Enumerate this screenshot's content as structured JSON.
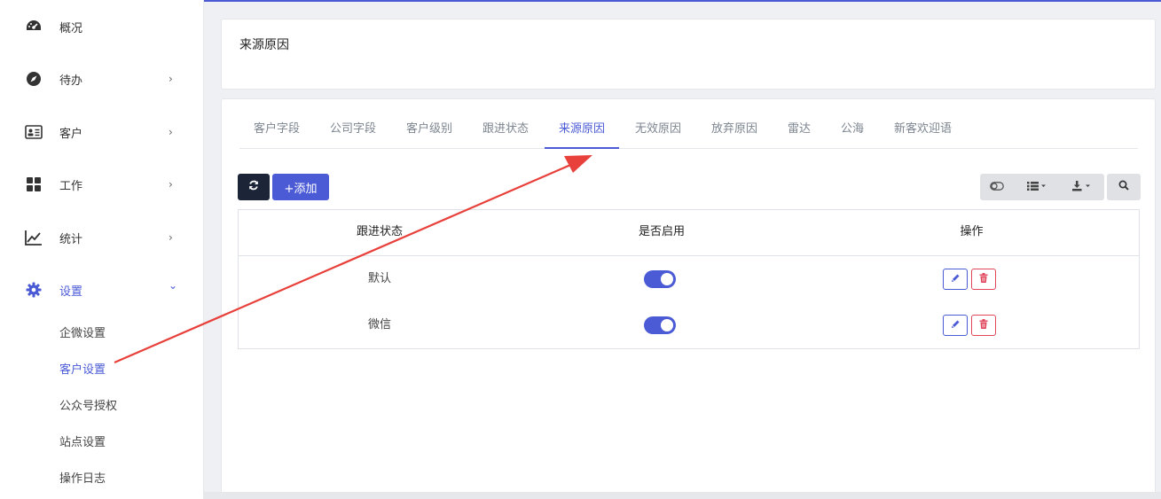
{
  "sidebar": {
    "items": [
      {
        "label": "概况",
        "icon": "dashboard-icon",
        "chevron": ""
      },
      {
        "label": "待办",
        "icon": "compass-icon",
        "chevron": "›"
      },
      {
        "label": "客户",
        "icon": "id-card-icon",
        "chevron": "›"
      },
      {
        "label": "工作",
        "icon": "grid-icon",
        "chevron": "›"
      },
      {
        "label": "统计",
        "icon": "line-chart-icon",
        "chevron": "›"
      },
      {
        "label": "设置",
        "icon": "gear-icon",
        "chevron": "⌄"
      }
    ],
    "sub_items": [
      "企微设置",
      "客户设置",
      "公众号授权",
      "站点设置",
      "操作日志"
    ]
  },
  "page": {
    "title": "来源原因"
  },
  "tabs": [
    "客户字段",
    "公司字段",
    "客户级别",
    "跟进状态",
    "来源原因",
    "无效原因",
    "放弃原因",
    "雷达",
    "公海",
    "新客欢迎语"
  ],
  "active_tab": "来源原因",
  "toolbar": {
    "add_label": "+添加"
  },
  "table": {
    "headers": [
      "跟进状态",
      "是否启用",
      "操作"
    ],
    "rows": [
      {
        "name": "默认",
        "enabled": true
      },
      {
        "name": "微信",
        "enabled": true
      }
    ]
  },
  "colors": {
    "accent": "#4b5bd6",
    "dark_button": "#1b2537",
    "danger": "#e0455b",
    "annotation_arrow": "#e8403a"
  }
}
